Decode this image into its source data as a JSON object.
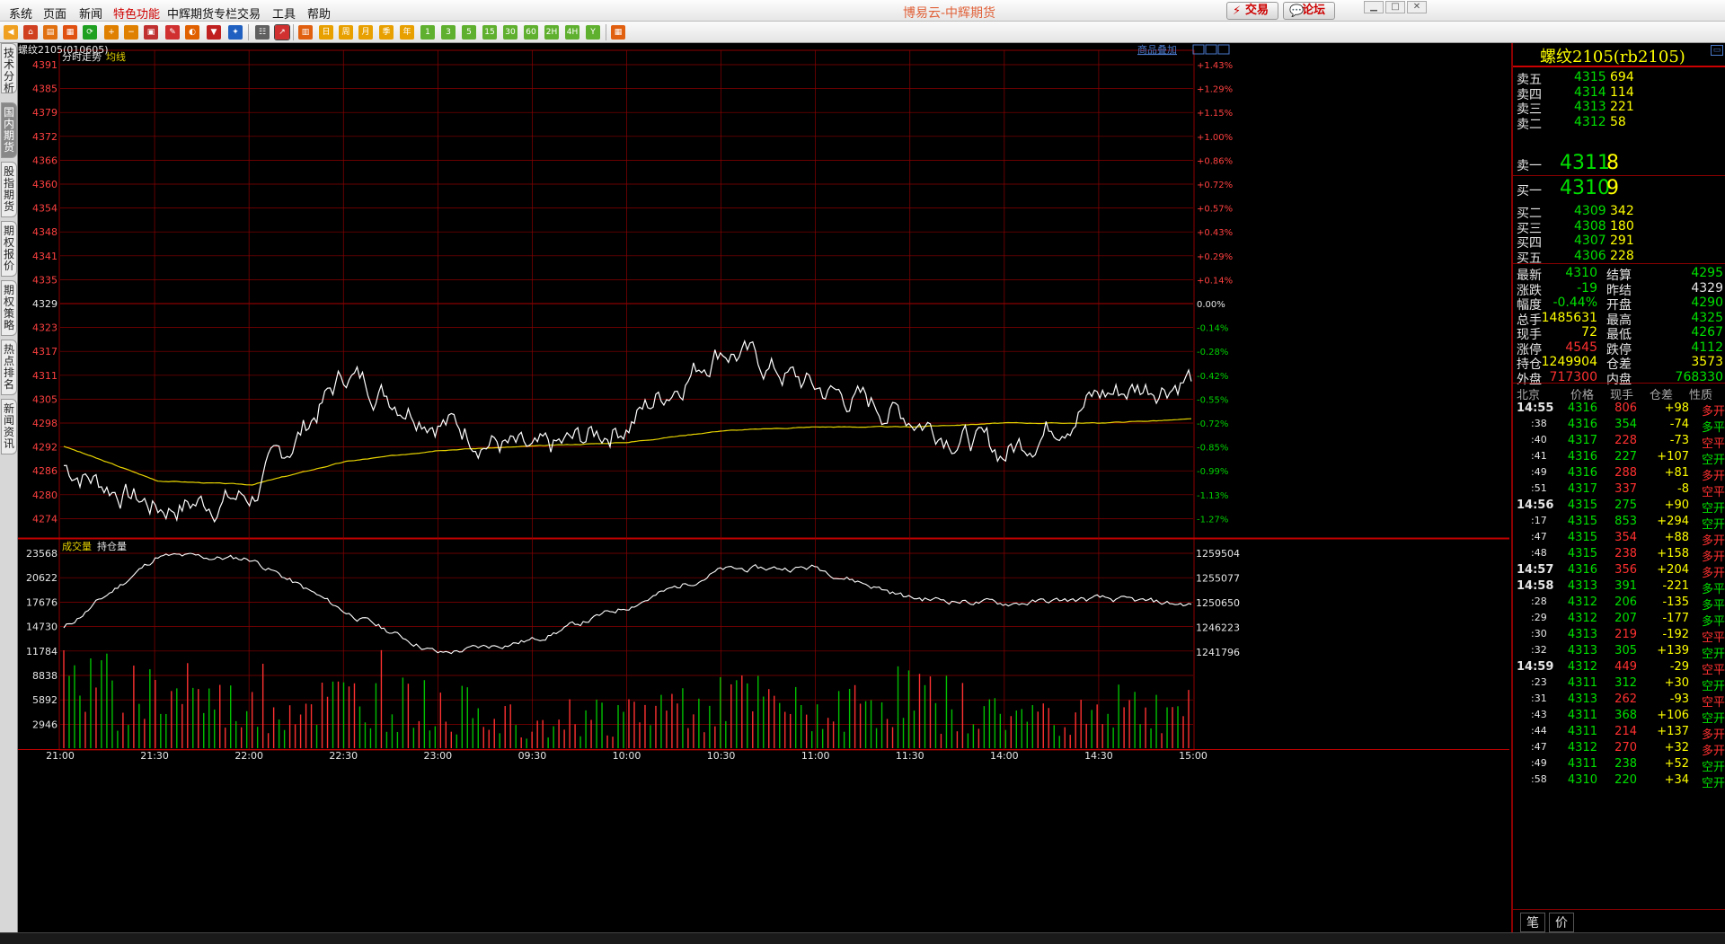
{
  "menu": {
    "items": [
      "系统",
      "页面",
      "新闻",
      "特色功能",
      "中辉期货专栏",
      "交易",
      "工具",
      "帮助"
    ],
    "highlighted_index": 3,
    "title": "博易云-中辉期货",
    "trade_label": "交易",
    "forum_label": "论坛"
  },
  "toolbar": {
    "period_buttons": [
      "日",
      "周",
      "月",
      "季",
      "年",
      "1",
      "3",
      "5",
      "15",
      "30",
      "60",
      "2H",
      "4H",
      "Y"
    ]
  },
  "side_tabs": [
    "技术分析",
    "国内期货",
    "股指期货",
    "期权报价",
    "期权策略",
    "热点排名",
    "新闻资讯"
  ],
  "side_tab_active": 1,
  "chart": {
    "contract_label": "螺纹2105(010605)",
    "overlay_link": "商品叠加",
    "price_panel_label": "分时走势",
    "avg_label": "均线",
    "vol_panel_label": "成交量",
    "oi_label": "持仓量",
    "price_ticks": [
      "4391",
      "4385",
      "4379",
      "4372",
      "4366",
      "4360",
      "4354",
      "4348",
      "4341",
      "4335",
      "4329",
      "4323",
      "4317",
      "4311",
      "4305",
      "4298",
      "4292",
      "4286",
      "4280",
      "4274"
    ],
    "pct_ticks": [
      "+1.43%",
      "+1.29%",
      "+1.15%",
      "+1.00%",
      "+0.86%",
      "+0.72%",
      "+0.57%",
      "+0.43%",
      "+0.29%",
      "+0.14%",
      "0.00%",
      "-0.14%",
      "-0.28%",
      "-0.42%",
      "-0.55%",
      "-0.72%",
      "-0.85%",
      "-0.99%",
      "-1.13%",
      "-1.27%"
    ],
    "vol_ticks": [
      "23568",
      "20622",
      "17676",
      "14730",
      "11784",
      "8838",
      "5892",
      "2946"
    ],
    "oi_ticks": [
      "1259504",
      "1255077",
      "1250650",
      "1246223",
      "1241796"
    ],
    "time_ticks": [
      "21:00",
      "21:30",
      "22:00",
      "22:30",
      "23:00",
      "09:30",
      "10:00",
      "10:30",
      "11:00",
      "11:30",
      "14:00",
      "14:30",
      "15:00"
    ],
    "colors": {
      "price_line": "#ffffff",
      "avg_line": "#e6d200",
      "grid": "#8b0000",
      "up": "#ff3030",
      "down": "#00c000",
      "text_red": "#ff4040"
    }
  },
  "chart_data": {
    "type": "line",
    "x": [
      "21:00",
      "21:30",
      "22:00",
      "22:30",
      "23:00",
      "09:30",
      "10:00",
      "10:30",
      "11:00",
      "11:30",
      "14:00",
      "14:30",
      "15:00"
    ],
    "series": [
      {
        "name": "分时走势",
        "values": [
          4287,
          4276,
          4279,
          4311,
          4299,
          4289,
          4298,
          4318,
          4307,
          4300,
          4290,
          4305,
          4310
        ]
      },
      {
        "name": "均线",
        "values": [
          4292,
          4283,
          4282,
          4288,
          4291,
          4292,
          4293,
          4296,
          4297,
          4297,
          4298,
          4298,
          4299
        ]
      },
      {
        "name": "持仓量",
        "values": [
          1246000,
          1259000,
          1258500,
          1249000,
          1241500,
          1244000,
          1250000,
          1256500,
          1257000,
          1251500,
          1250500,
          1251300,
          1250300
        ]
      },
      {
        "name": "成交量",
        "values": [
          9000,
          8000,
          5500,
          7000,
          6000,
          4500,
          5000,
          7500,
          5000,
          8000,
          4500,
          5500,
          6000
        ]
      }
    ],
    "ylim_price": [
      4271,
      4391
    ],
    "ylim_volume": [
      0,
      23568
    ],
    "ylim_oi": [
      1240000,
      1259504
    ]
  },
  "quote": {
    "title": "螺纹2105(rb2105)",
    "asks": [
      {
        "label": "卖五",
        "price": "4315",
        "vol": "694"
      },
      {
        "label": "卖四",
        "price": "4314",
        "vol": "114"
      },
      {
        "label": "卖三",
        "price": "4313",
        "vol": "221"
      },
      {
        "label": "卖二",
        "price": "4312",
        "vol": "58"
      }
    ],
    "ask1": {
      "label": "卖一",
      "price": "4311",
      "vol": "8"
    },
    "bid1": {
      "label": "买一",
      "price": "4310",
      "vol": "9"
    },
    "bids": [
      {
        "label": "买二",
        "price": "4309",
        "vol": "342"
      },
      {
        "label": "买三",
        "price": "4308",
        "vol": "180"
      },
      {
        "label": "买四",
        "price": "4307",
        "vol": "291"
      },
      {
        "label": "买五",
        "price": "4306",
        "vol": "228"
      }
    ],
    "stats": [
      {
        "l1": "最新",
        "v1": "4310",
        "c1": "g",
        "l2": "结算",
        "v2": "4295",
        "c2": "g"
      },
      {
        "l1": "涨跌",
        "v1": "-19",
        "c1": "g",
        "l2": "昨结",
        "v2": "4329",
        "c2": "w"
      },
      {
        "l1": "幅度",
        "v1": "-0.44%",
        "c1": "g",
        "l2": "开盘",
        "v2": "4290",
        "c2": "g"
      },
      {
        "l1": "总手",
        "v1": "1485631",
        "c1": "y",
        "l2": "最高",
        "v2": "4325",
        "c2": "g"
      },
      {
        "l1": "现手",
        "v1": "72",
        "c1": "y",
        "l2": "最低",
        "v2": "4267",
        "c2": "g"
      },
      {
        "l1": "涨停",
        "v1": "4545",
        "c1": "r",
        "l2": "跌停",
        "v2": "4112",
        "c2": "g"
      },
      {
        "l1": "持仓",
        "v1": "1249904",
        "c1": "y",
        "l2": "仓差",
        "v2": "3573",
        "c2": "y"
      },
      {
        "l1": "外盘",
        "v1": "717300",
        "c1": "r",
        "l2": "内盘",
        "v2": "768330",
        "c2": "g"
      }
    ],
    "ticks_header": {
      "c1": "北京",
      "c2": "价格",
      "c3": "现手",
      "c4": "仓差",
      "c5": "性质"
    },
    "ticks": [
      {
        "t": "14:55",
        "p": "4316",
        "v": "806",
        "d": "+98",
        "k": "多开",
        "pc": "g",
        "vc": "r",
        "dc": "y",
        "kc": "r",
        "big": true
      },
      {
        "t": ":38",
        "p": "4316",
        "v": "354",
        "d": "-74",
        "k": "多平",
        "pc": "g",
        "vc": "g",
        "dc": "y",
        "kc": "g",
        "big": false
      },
      {
        "t": ":40",
        "p": "4317",
        "v": "228",
        "d": "-73",
        "k": "空平",
        "pc": "g",
        "vc": "r",
        "dc": "y",
        "kc": "r",
        "big": false
      },
      {
        "t": ":41",
        "p": "4316",
        "v": "227",
        "d": "+107",
        "k": "空开",
        "pc": "g",
        "vc": "g",
        "dc": "y",
        "kc": "g",
        "big": false
      },
      {
        "t": ":49",
        "p": "4316",
        "v": "288",
        "d": "+81",
        "k": "多开",
        "pc": "g",
        "vc": "r",
        "dc": "y",
        "kc": "r",
        "big": false
      },
      {
        "t": ":51",
        "p": "4317",
        "v": "337",
        "d": "-8",
        "k": "空平",
        "pc": "g",
        "vc": "r",
        "dc": "y",
        "kc": "r",
        "big": false
      },
      {
        "t": "14:56",
        "p": "4315",
        "v": "275",
        "d": "+90",
        "k": "空开",
        "pc": "g",
        "vc": "g",
        "dc": "y",
        "kc": "g",
        "big": true
      },
      {
        "t": ":17",
        "p": "4315",
        "v": "853",
        "d": "+294",
        "k": "空开",
        "pc": "g",
        "vc": "g",
        "dc": "y",
        "kc": "g",
        "big": false
      },
      {
        "t": ":47",
        "p": "4315",
        "v": "354",
        "d": "+88",
        "k": "多开",
        "pc": "g",
        "vc": "r",
        "dc": "y",
        "kc": "r",
        "big": false
      },
      {
        "t": ":48",
        "p": "4315",
        "v": "238",
        "d": "+158",
        "k": "多开",
        "pc": "g",
        "vc": "r",
        "dc": "y",
        "kc": "r",
        "big": false
      },
      {
        "t": "14:57",
        "p": "4316",
        "v": "356",
        "d": "+204",
        "k": "多开",
        "pc": "g",
        "vc": "r",
        "dc": "y",
        "kc": "r",
        "big": true
      },
      {
        "t": "14:58",
        "p": "4313",
        "v": "391",
        "d": "-221",
        "k": "多平",
        "pc": "g",
        "vc": "g",
        "dc": "y",
        "kc": "g",
        "big": true
      },
      {
        "t": ":28",
        "p": "4312",
        "v": "206",
        "d": "-135",
        "k": "多平",
        "pc": "g",
        "vc": "g",
        "dc": "y",
        "kc": "g",
        "big": false
      },
      {
        "t": ":29",
        "p": "4312",
        "v": "207",
        "d": "-177",
        "k": "多平",
        "pc": "g",
        "vc": "g",
        "dc": "y",
        "kc": "g",
        "big": false
      },
      {
        "t": ":30",
        "p": "4313",
        "v": "219",
        "d": "-192",
        "k": "空平",
        "pc": "g",
        "vc": "r",
        "dc": "y",
        "kc": "r",
        "big": false
      },
      {
        "t": ":32",
        "p": "4313",
        "v": "305",
        "d": "+139",
        "k": "空开",
        "pc": "g",
        "vc": "g",
        "dc": "y",
        "kc": "g",
        "big": false
      },
      {
        "t": "14:59",
        "p": "4312",
        "v": "449",
        "d": "-29",
        "k": "空平",
        "pc": "g",
        "vc": "r",
        "dc": "y",
        "kc": "r",
        "big": true
      },
      {
        "t": ":23",
        "p": "4311",
        "v": "312",
        "d": "+30",
        "k": "空开",
        "pc": "g",
        "vc": "g",
        "dc": "y",
        "kc": "g",
        "big": false
      },
      {
        "t": ":31",
        "p": "4313",
        "v": "262",
        "d": "-93",
        "k": "空平",
        "pc": "g",
        "vc": "r",
        "dc": "y",
        "kc": "r",
        "big": false
      },
      {
        "t": ":43",
        "p": "4311",
        "v": "368",
        "d": "+106",
        "k": "空开",
        "pc": "g",
        "vc": "g",
        "dc": "y",
        "kc": "g",
        "big": false
      },
      {
        "t": ":44",
        "p": "4311",
        "v": "214",
        "d": "+137",
        "k": "多开",
        "pc": "g",
        "vc": "r",
        "dc": "y",
        "kc": "r",
        "big": false
      },
      {
        "t": ":47",
        "p": "4312",
        "v": "270",
        "d": "+32",
        "k": "多开",
        "pc": "g",
        "vc": "r",
        "dc": "y",
        "kc": "r",
        "big": false
      },
      {
        "t": ":49",
        "p": "4311",
        "v": "238",
        "d": "+52",
        "k": "空开",
        "pc": "g",
        "vc": "g",
        "dc": "y",
        "kc": "g",
        "big": false
      },
      {
        "t": ":58",
        "p": "4310",
        "v": "220",
        "d": "+34",
        "k": "空开",
        "pc": "g",
        "vc": "g",
        "dc": "y",
        "kc": "g",
        "big": false
      }
    ],
    "bottom_tabs": [
      "笔",
      "价"
    ]
  }
}
